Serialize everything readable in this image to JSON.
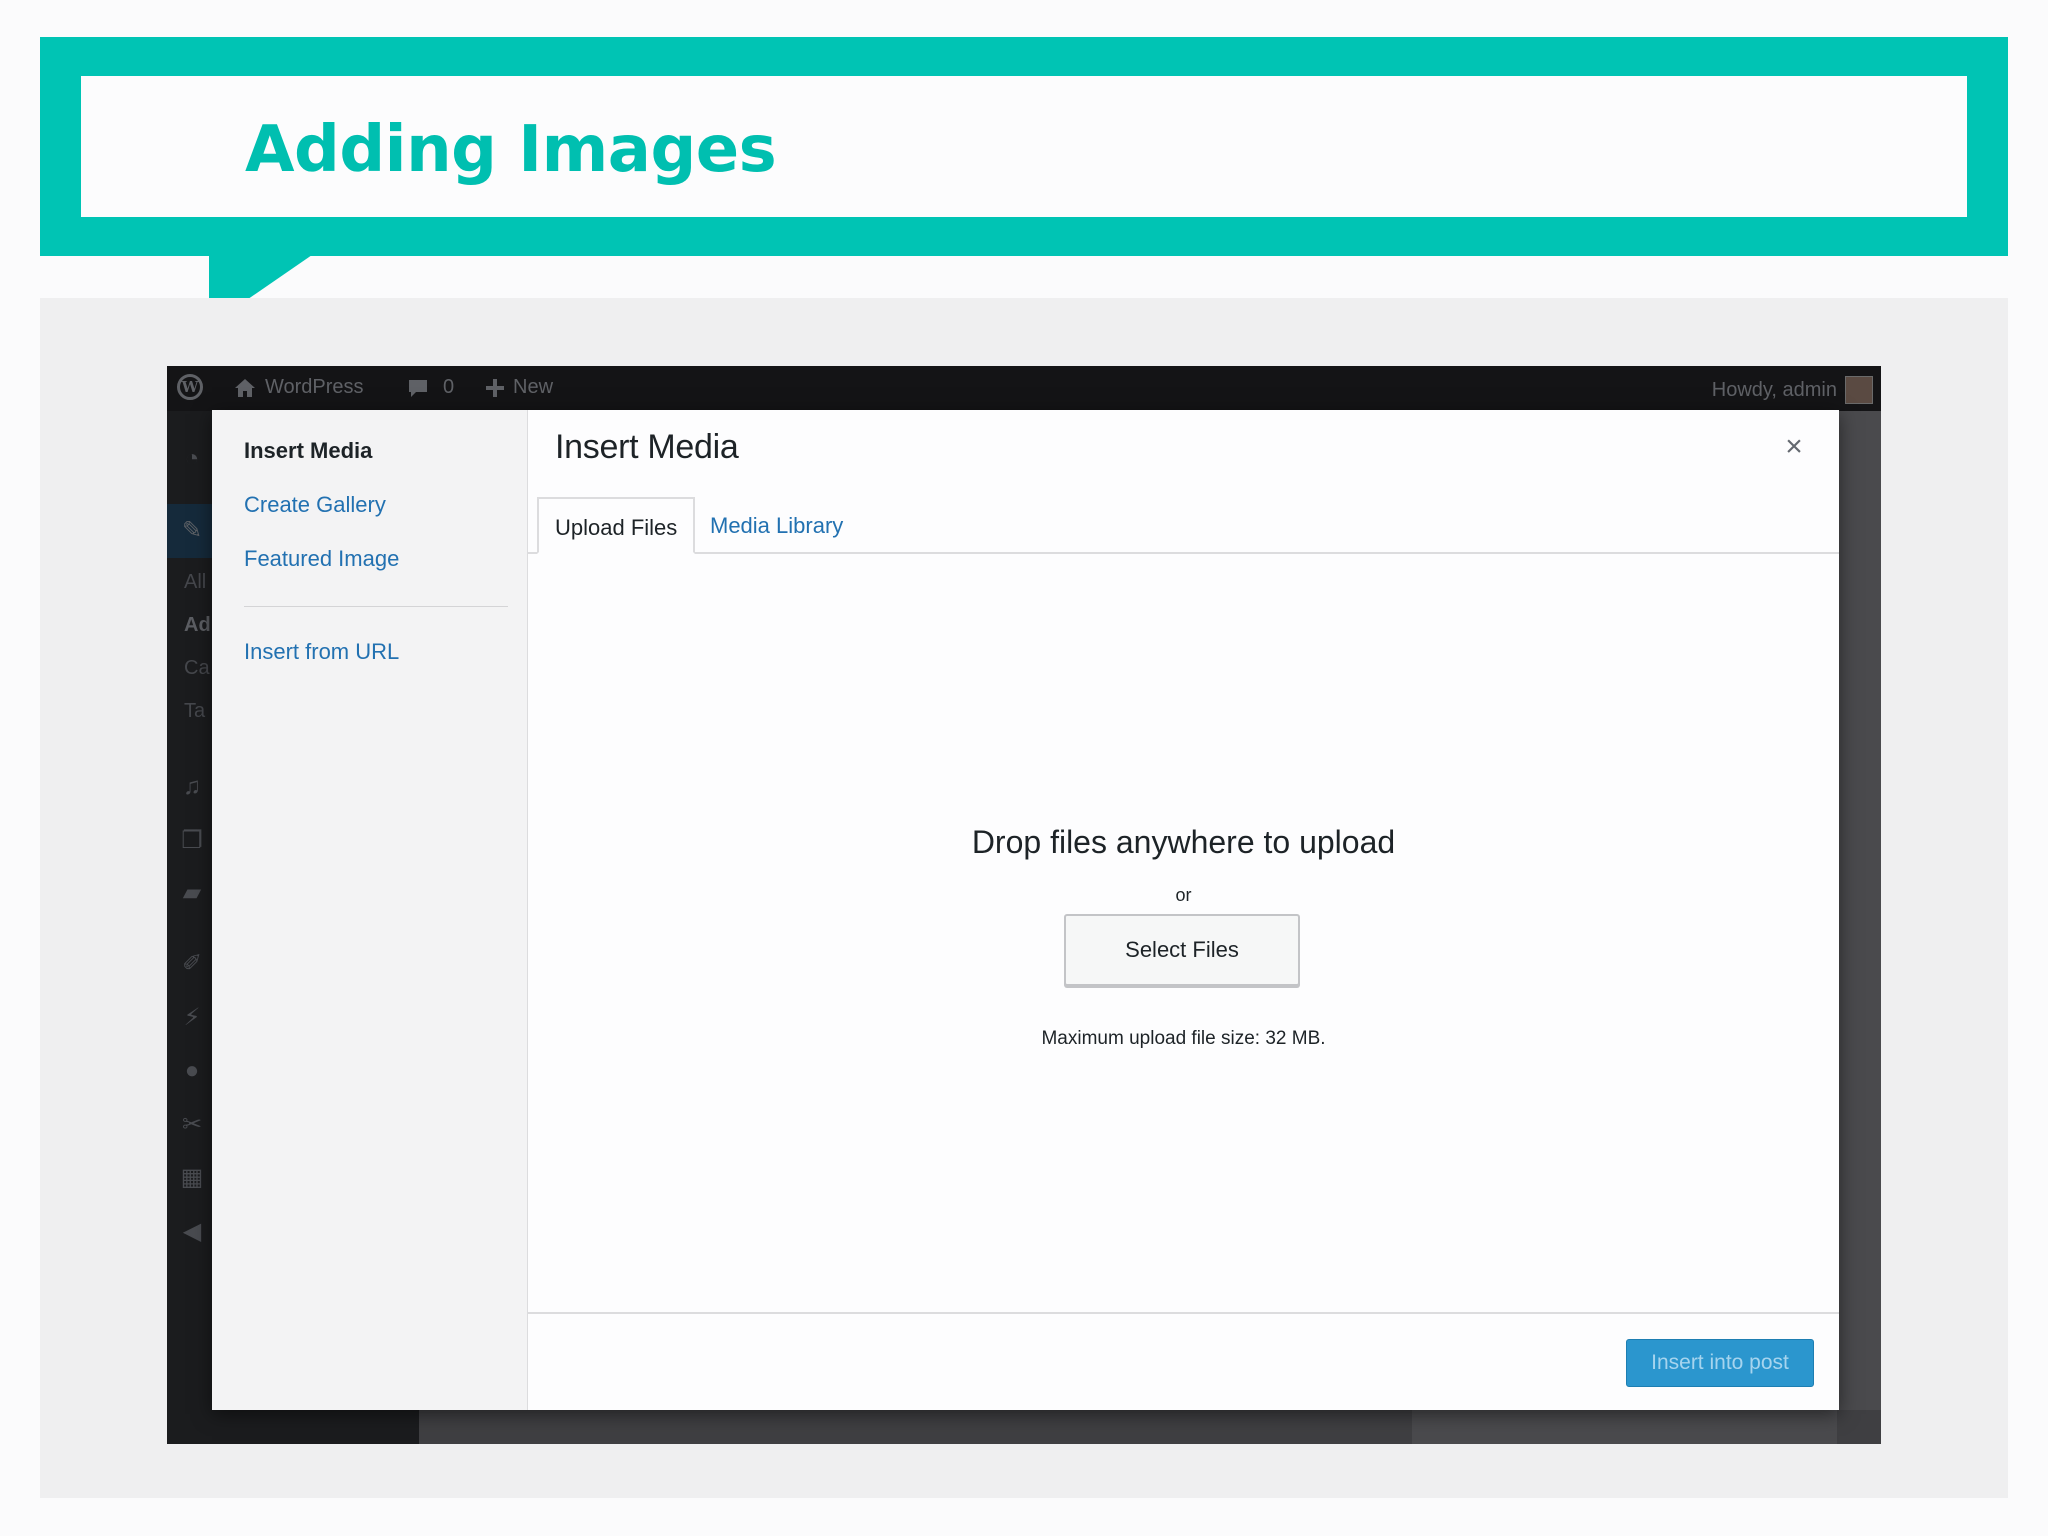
{
  "slide": {
    "title": "Adding Images"
  },
  "admin_bar": {
    "site_name": "WordPress",
    "comments_count": "0",
    "new_label": "New",
    "greeting": "Howdy, admin"
  },
  "admin_sidebar": {
    "submenu": [
      "All",
      "Ad",
      "Ca",
      "Ta"
    ]
  },
  "modal": {
    "title": "Insert Media",
    "close_icon": "×",
    "menu": {
      "insert_media": "Insert Media",
      "create_gallery": "Create Gallery",
      "featured_image": "Featured Image",
      "insert_from_url": "Insert from URL"
    },
    "tabs": {
      "upload_files": "Upload Files",
      "media_library": "Media Library"
    },
    "uploader": {
      "drop_text": "Drop files anywhere to upload",
      "or_text": "or",
      "select_files": "Select Files",
      "max_size": "Maximum upload file size: 32 MB."
    },
    "toolbar": {
      "insert_button": "Insert into post"
    }
  },
  "colors": {
    "accent_teal": "#00c4b4",
    "link_blue": "#2271b1",
    "primary_button": "#2b96ce"
  }
}
